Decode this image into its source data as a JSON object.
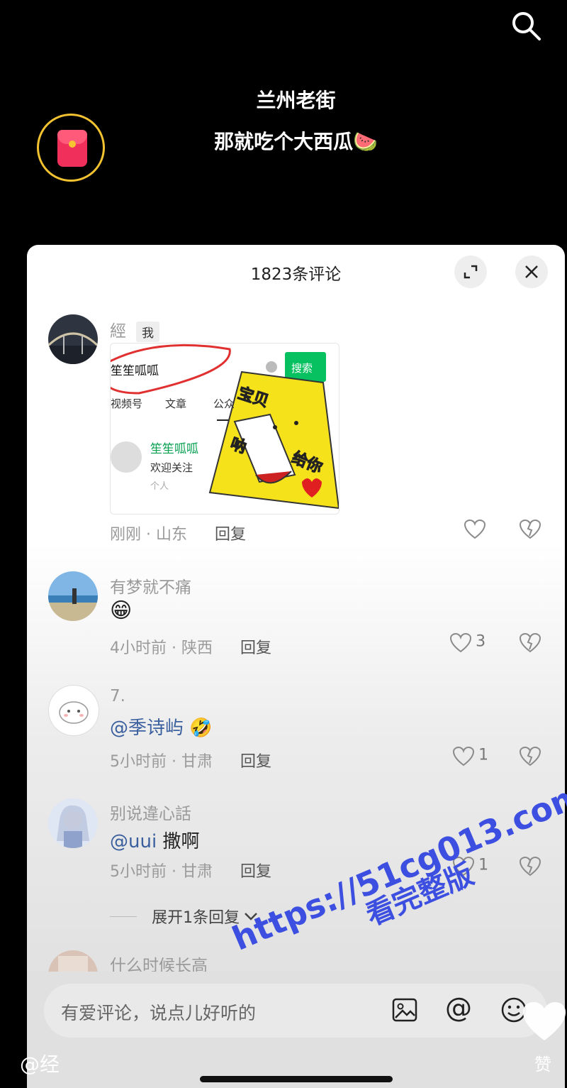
{
  "video": {
    "title": "兰州老街",
    "subtitle": "那就吃个大西瓜🍉",
    "author_handle": "@经",
    "like_label": "赞"
  },
  "comments_panel": {
    "title": "1823条评论",
    "comments": [
      {
        "user": "經",
        "badge": "我",
        "text": "",
        "image": {
          "search_text": "笙笙呱呱",
          "search_button": "搜索",
          "tab1": "视频号",
          "tab2": "文章",
          "tab3": "公众",
          "account_name": "笙笙呱呱",
          "account_desc": "欢迎关注",
          "account_type": "个人",
          "sticker_1": "宝贝",
          "sticker_2": "呐",
          "sticker_3": "给你"
        },
        "meta": "刚刚 · 山东",
        "reply": "回复",
        "likes": ""
      },
      {
        "user": "有梦就不痛",
        "text": "😁",
        "meta": "4小时前 · 陕西",
        "reply": "回复",
        "likes": "3"
      },
      {
        "user": "7.",
        "mention": "@季诗屿",
        "text": "🤣",
        "meta": "5小时前 · 甘肃",
        "reply": "回复",
        "likes": "1"
      },
      {
        "user": "别说違心話",
        "mention": "@uui",
        "text": "撒啊",
        "meta": "5小时前 · 甘肃",
        "reply": "回复",
        "likes": "1"
      },
      {
        "user": "什么时候长高"
      }
    ],
    "expand_replies": "展开1条回复"
  },
  "input": {
    "placeholder": "有爱评论，说点儿好听的",
    "at_symbol": "@"
  },
  "watermark": {
    "url": "https://51cg013.com",
    "caption": "看完整版"
  },
  "colors": {
    "accent_ring": "#f2c230",
    "red_packet": "#f0305a",
    "mention": "#3a5f9e",
    "watermark": "#3c4fe0"
  }
}
